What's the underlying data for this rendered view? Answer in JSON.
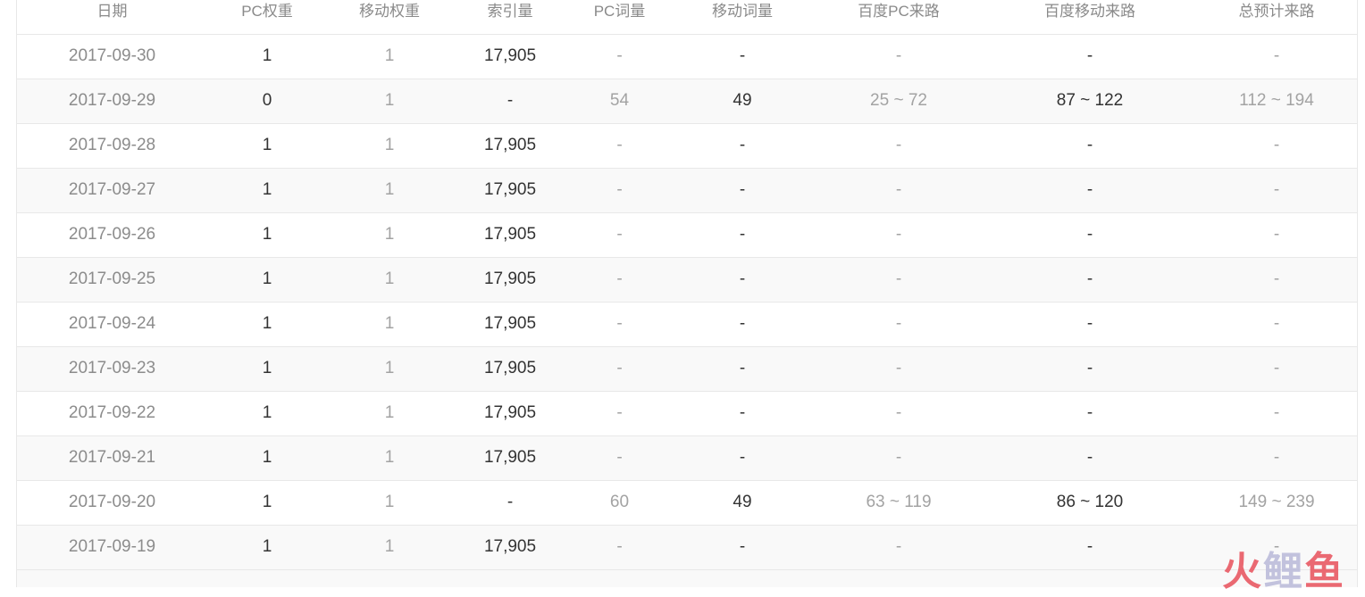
{
  "table": {
    "headers": [
      "日期",
      "PC权重",
      "移动权重",
      "索引量",
      "PC词量",
      "移动词量",
      "百度PC来路",
      "百度移动来路",
      "总预计来路"
    ],
    "rows": [
      [
        "2017-09-30",
        "1",
        "1",
        "17,905",
        "-",
        "-",
        "-",
        "-",
        "-"
      ],
      [
        "2017-09-29",
        "0",
        "1",
        "-",
        "54",
        "49",
        "25 ~ 72",
        "87 ~ 122",
        "112 ~ 194"
      ],
      [
        "2017-09-28",
        "1",
        "1",
        "17,905",
        "-",
        "-",
        "-",
        "-",
        "-"
      ],
      [
        "2017-09-27",
        "1",
        "1",
        "17,905",
        "-",
        "-",
        "-",
        "-",
        "-"
      ],
      [
        "2017-09-26",
        "1",
        "1",
        "17,905",
        "-",
        "-",
        "-",
        "-",
        "-"
      ],
      [
        "2017-09-25",
        "1",
        "1",
        "17,905",
        "-",
        "-",
        "-",
        "-",
        "-"
      ],
      [
        "2017-09-24",
        "1",
        "1",
        "17,905",
        "-",
        "-",
        "-",
        "-",
        "-"
      ],
      [
        "2017-09-23",
        "1",
        "1",
        "17,905",
        "-",
        "-",
        "-",
        "-",
        "-"
      ],
      [
        "2017-09-22",
        "1",
        "1",
        "17,905",
        "-",
        "-",
        "-",
        "-",
        "-"
      ],
      [
        "2017-09-21",
        "1",
        "1",
        "17,905",
        "-",
        "-",
        "-",
        "-",
        "-"
      ],
      [
        "2017-09-20",
        "1",
        "1",
        "-",
        "60",
        "49",
        "63 ~ 119",
        "86 ~ 120",
        "149 ~ 239"
      ],
      [
        "2017-09-19",
        "1",
        "1",
        "17,905",
        "-",
        "-",
        "-",
        "-",
        "-"
      ]
    ]
  },
  "watermark": {
    "chars": [
      "火",
      "鲤",
      "鱼"
    ]
  },
  "colors": {
    "border": "#e8e8e8",
    "text_dark": "#333333",
    "text_muted": "#a3a3a3",
    "row_shaded": "#f9f9f9",
    "watermark_red": "#e8505b"
  }
}
